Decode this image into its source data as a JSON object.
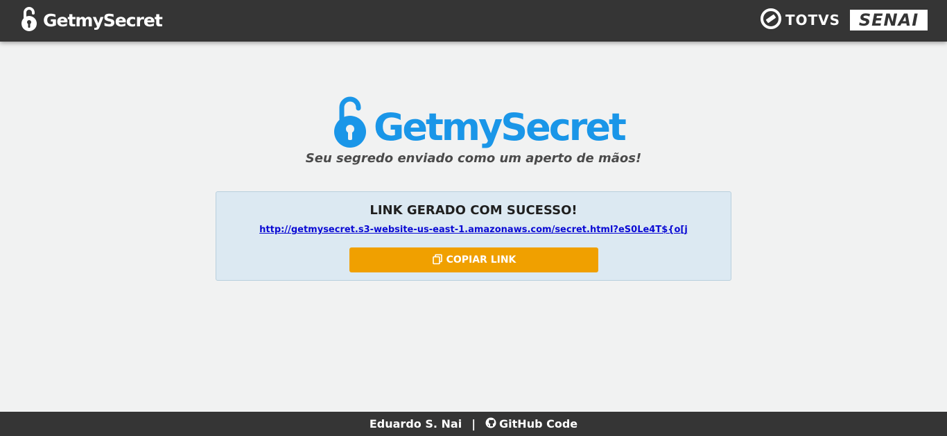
{
  "header": {
    "brand_name": "GetmySecret",
    "brand_icon": "unlocked-padlock-icon",
    "partners": {
      "totvs_label": "TOTVS",
      "totvs_icon": "totvs-logo-icon",
      "senai_label": "SENAI"
    }
  },
  "hero": {
    "brand_name": "GetmySecret",
    "brand_icon": "unlocked-padlock-icon",
    "tagline": "Seu segredo enviado como um aperto de mãos!"
  },
  "result": {
    "title": "LINK GERADO COM SUCESSO!",
    "link": "http://getmysecret.s3-website-us-east-1.amazonaws.com/secret.html?eS0Le4T${o[j",
    "copy_button_label": "COPIAR LINK",
    "copy_icon": "copy-icon"
  },
  "footer": {
    "author": "Eduardo S. Nai",
    "separator": "|",
    "github_label": "GitHub Code",
    "github_icon": "github-icon"
  },
  "colors": {
    "header_bg": "#353535",
    "page_bg": "#f1f2f2",
    "brand_blue": "#1a96e8",
    "panel_bg": "#dce9f2",
    "button_orange": "#f0a000",
    "link_blue": "#0b0bd4"
  }
}
